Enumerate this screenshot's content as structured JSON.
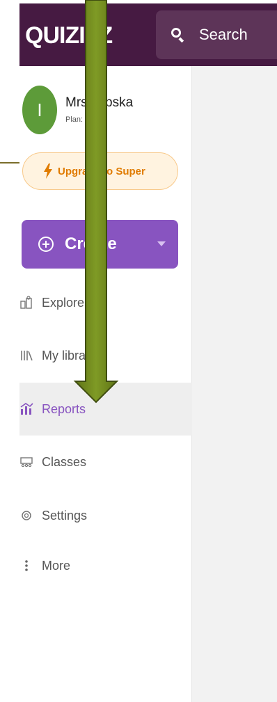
{
  "header": {
    "logo_text": "QUIZIZZ",
    "search_label": "Search"
  },
  "profile": {
    "initial": "I",
    "name": "Mrs. Lipska",
    "plan": "Plan: Basic"
  },
  "upgrade": {
    "label": "Upgrade to Super"
  },
  "create": {
    "label": "Create"
  },
  "nav": [
    {
      "label": "Explore",
      "icon": "explore-icon"
    },
    {
      "label": "My library",
      "icon": "library-icon"
    },
    {
      "label": "Reports",
      "icon": "reports-icon",
      "active": true
    },
    {
      "label": "Classes",
      "icon": "classes-icon"
    },
    {
      "label": "Settings",
      "icon": "gear-icon"
    },
    {
      "label": "More",
      "icon": "more-icon"
    }
  ],
  "colors": {
    "topbar": "#461a42",
    "accent": "#8854c0",
    "avatar": "#5d9b39",
    "upgrade_text": "#e07b00",
    "arrow": "#77901f"
  }
}
